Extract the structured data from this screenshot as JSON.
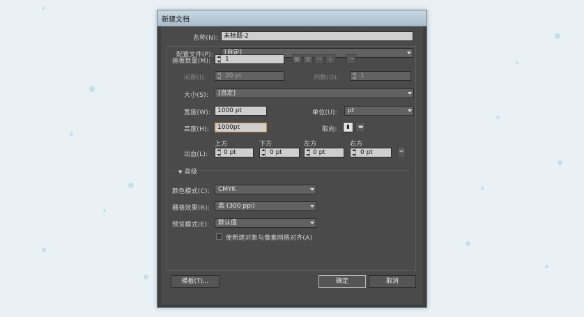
{
  "window": {
    "title": "新建文档"
  },
  "form": {
    "name_label": "名称(N):",
    "name_value": "未标题-2",
    "profile_label": "配置文件(P):",
    "profile_value": "[自定]",
    "artboards_label": "画板数量(M):",
    "artboards_value": "1",
    "spacing_label": "间距(I):",
    "spacing_value": "20 pt",
    "columns_label": "列数(O):",
    "columns_value": "1",
    "size_label": "大小(S):",
    "size_value": "[自定]",
    "width_label": "宽度(W):",
    "width_value": "1000 pt",
    "units_label": "单位(U):",
    "units_value": "pt",
    "height_label": "高度(H):",
    "height_value": "1000pt",
    "orientation_label": "取向:",
    "bleed_label": "出血(L):",
    "bleed": [
      {
        "label": "上方",
        "value": "0 pt"
      },
      {
        "label": "下方",
        "value": "0 pt"
      },
      {
        "label": "左方",
        "value": "0 pt"
      },
      {
        "label": "右方",
        "value": "0 pt"
      }
    ],
    "advanced_label": "高级",
    "color_mode_label": "颜色模式(C):",
    "color_mode_value": "CMYK",
    "raster_label": "栅格效果(R):",
    "raster_value": "高 (300 ppi)",
    "preview_label": "预览模式(E):",
    "preview_value": "默认值",
    "align_pixel_label": "使新建对象与像素网格对齐(A)"
  },
  "buttons": {
    "templates": "模板(T)...",
    "ok": "确定",
    "cancel": "取消"
  },
  "icons": {
    "grid_by_row": "grid-by-row-icon",
    "grid_by_column": "grid-by-column-icon",
    "arrange_by_row": "arrange-by-row-icon",
    "arrange_by_column": "arrange-by-column-icon",
    "right_to_left": "right-to-left-icon",
    "portrait": "portrait-icon",
    "landscape": "landscape-icon",
    "link": "link-chain-icon"
  },
  "colors": {
    "dialog": "#4a4a4a",
    "focus": "#d0862e",
    "field": "#cfcfcf"
  }
}
